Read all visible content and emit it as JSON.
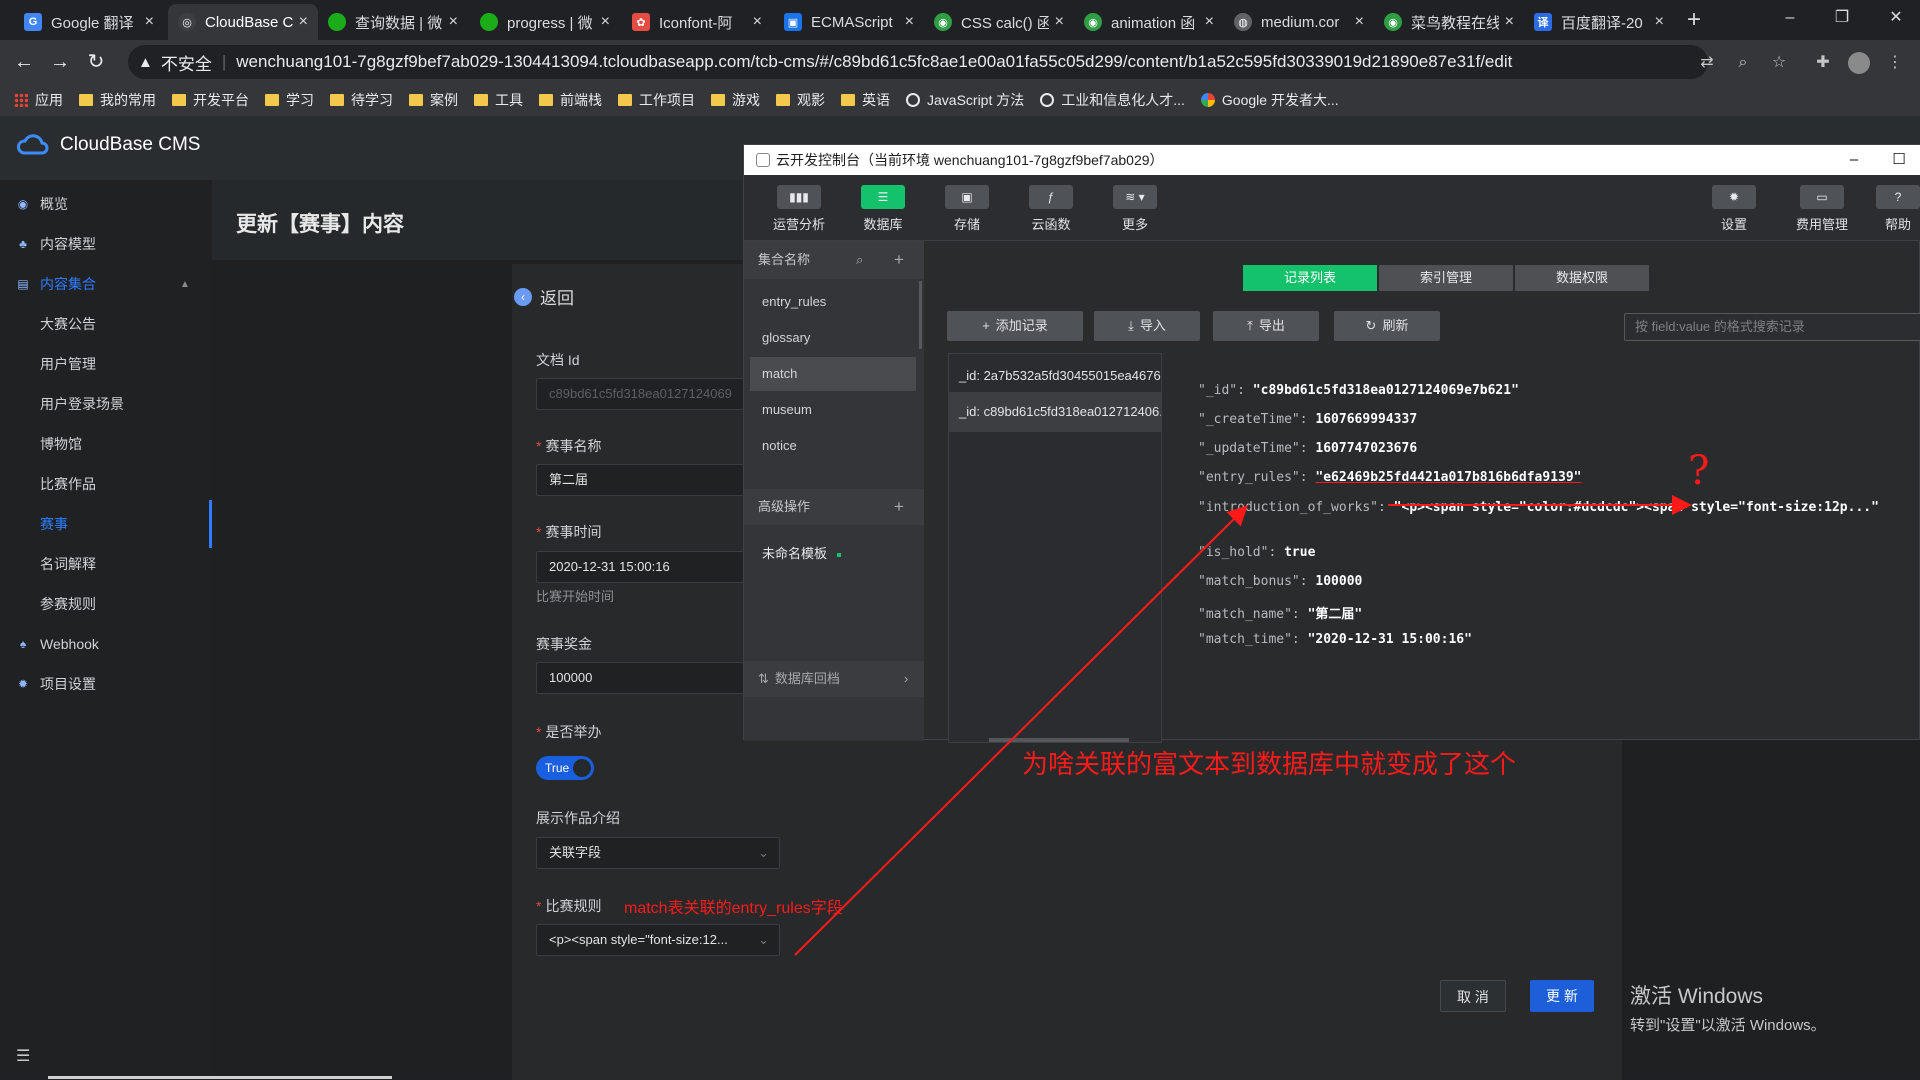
{
  "browser": {
    "tabs": [
      {
        "label": "Google 翻译",
        "color": "#4285f4",
        "glyph": "G"
      },
      {
        "label": "CloudBase C",
        "color": "#3c4043",
        "glyph": "◎"
      },
      {
        "label": "查询数据 | 微",
        "color": "#1aad19",
        "glyph": "●"
      },
      {
        "label": "progress | 微",
        "color": "#1aad19",
        "glyph": "●"
      },
      {
        "label": "Iconfont-阿",
        "color": "#e54d42",
        "glyph": "✿"
      },
      {
        "label": "ECMAScript",
        "color": "#1a73e8",
        "glyph": "▣"
      },
      {
        "label": "CSS calc() 函",
        "color": "#2f9e44",
        "glyph": "◉"
      },
      {
        "label": "animation 函",
        "color": "#2f9e44",
        "glyph": "◉"
      },
      {
        "label": "medium.cor",
        "color": "#5f6368",
        "glyph": "◍"
      },
      {
        "label": "菜鸟教程在线",
        "color": "#2f9e44",
        "glyph": "◉"
      },
      {
        "label": "百度翻译-20",
        "color": "#2b6de8",
        "glyph": "译"
      }
    ],
    "insecure_label": "不安全",
    "url": "wenchuang101-7g8gzf9bef7ab029-1304413094.tcloudbaseapp.com/tcb-cms/#/c89bd61c5fc8ae1e00a01fa55c05d299/content/b1a52c595fd30339019d21890e87e31f/edit",
    "bookmarks": [
      "应用",
      "我的常用",
      "开发平台",
      "学习",
      "待学习",
      "案例",
      "工具",
      "前端栈",
      "工作项目",
      "游戏",
      "观影",
      "英语",
      "JavaScript 方法",
      "工业和信息化人才...",
      "Google 开发者大..."
    ]
  },
  "cms": {
    "brand": "CloudBase CMS",
    "menu": [
      "概览",
      "内容模型",
      "内容集合"
    ],
    "collections": [
      "大赛公告",
      "用户管理",
      "用户登录场景",
      "博物馆",
      "比赛作品",
      "赛事",
      "名词解释",
      "参赛规则"
    ],
    "menu_bottom": [
      "Webhook",
      "项目设置"
    ],
    "page_title": "更新【赛事】内容",
    "back_label": "返回",
    "form": {
      "doc_id_label": "文档 Id",
      "doc_id_value": "c89bd61c5fd318ea0127124069",
      "name_label": "赛事名称",
      "name_value": "第二届",
      "time_label": "赛事时间",
      "time_value": "2020-12-31 15:00:16",
      "time_help": "比赛开始时间",
      "bonus_label": "赛事奖金",
      "bonus_value": "100000",
      "hold_label": "是否举办",
      "hold_value": "True",
      "intro_label": "展示作品介绍",
      "intro_value": "关联字段",
      "rules_label": "比赛规则",
      "rules_value": "<p><span style=\"font-size:12..."
    },
    "cancel_label": "取 消",
    "update_label": "更 新"
  },
  "windows_activation": {
    "line1": "激活 Windows",
    "line2": "转到\"设置\"以激活 Windows。"
  },
  "console": {
    "title": "云开发控制台（当前环境 wenchuang101-7g8gzf9bef7ab029）",
    "tools": [
      "运营分析",
      "数据库",
      "存储",
      "云函数",
      "更多"
    ],
    "right_tools": [
      "设置",
      "费用管理",
      "帮助"
    ],
    "collections_header": "集合名称",
    "collections": [
      "entry_rules",
      "glossary",
      "match",
      "museum",
      "notice"
    ],
    "advanced_header": "高级操作",
    "template_item": "未命名模板",
    "db_backup": "数据库回档",
    "segments": [
      "记录列表",
      "索引管理",
      "数据权限"
    ],
    "actions": [
      "添加记录",
      "导入",
      "导出",
      "刷新"
    ],
    "search_placeholder": "按 field:value 的格式搜索记录",
    "records": [
      "_id: 2a7b532a5fd30455015ea4676...",
      "_id: c89bd61c5fd318ea012712406..."
    ],
    "fields": [
      {
        "key": "\"_id\":",
        "value": "\"c89bd61c5fd318ea0127124069e7b621\""
      },
      {
        "key": "\"_createTime\":",
        "value": "1607669994337"
      },
      {
        "key": "\"_updateTime\":",
        "value": "1607747023676"
      },
      {
        "key": "\"entry_rules\":",
        "value": "\"e62469b25fd4421a017b816b6dfa9139\""
      },
      {
        "key": "\"introduction_of_works\":",
        "value": "\"<p><span style=\"color:#dcdcdc\"><span style=\"font-size:12p...\""
      },
      {
        "key": "\"is_hold\":",
        "value": "true"
      },
      {
        "key": "\"match_bonus\":",
        "value": "100000"
      },
      {
        "key": "\"match_name\":",
        "value": "\"第二届\""
      },
      {
        "key": "\"match_time\":",
        "value": "\"2020-12-31 15:00:16\""
      }
    ]
  },
  "annotations": {
    "question_mark": "?",
    "main": "为啥关联的富文本到数据库中就变成了这个",
    "field_note": "match表关联的entry_rules字段"
  }
}
